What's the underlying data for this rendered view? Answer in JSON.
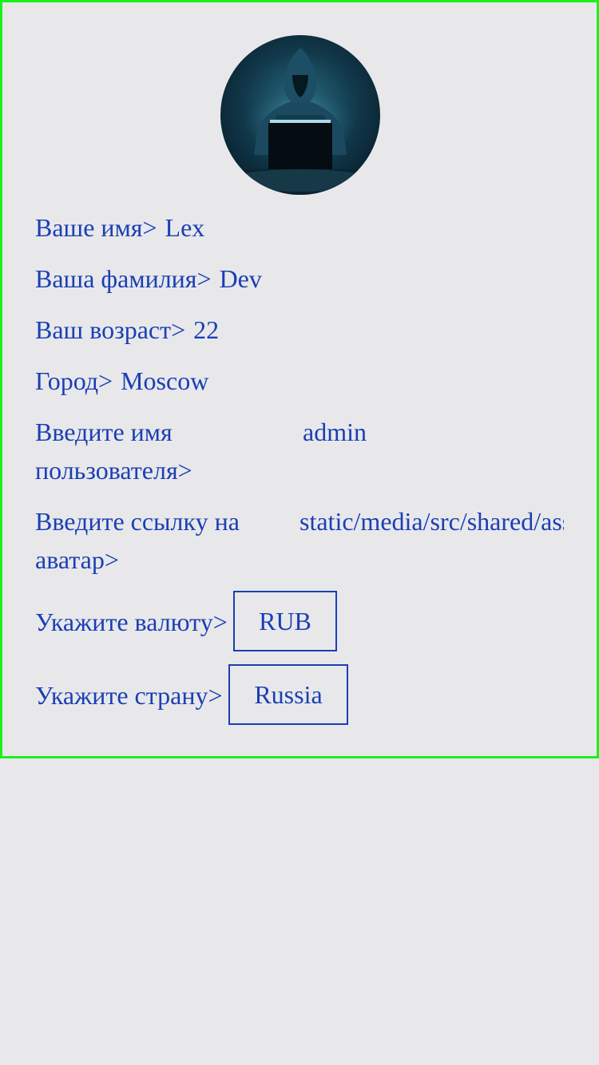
{
  "profile": {
    "avatar_icon": "hooded-hacker-avatar",
    "fields": [
      {
        "label": "Ваше имя>",
        "value": "Lex"
      },
      {
        "label": "Ваша фамилия>",
        "value": "Dev"
      },
      {
        "label": "Ваш возраст>",
        "value": "22"
      },
      {
        "label": "Город>",
        "value": "Moscow"
      }
    ],
    "username": {
      "label": "Введите имя пользователя>",
      "value": "admin"
    },
    "avatar_link": {
      "label": "Введите ссылку на аватар>",
      "value": "static/media/src/shared/assets"
    },
    "currency": {
      "label": "Укажите валюту>",
      "value": "RUB"
    },
    "country": {
      "label": "Укажите страну>",
      "value": "Russia"
    }
  },
  "colors": {
    "text": "#1a3fb4",
    "border": "#19f21a",
    "background": "#e8e8eb"
  }
}
